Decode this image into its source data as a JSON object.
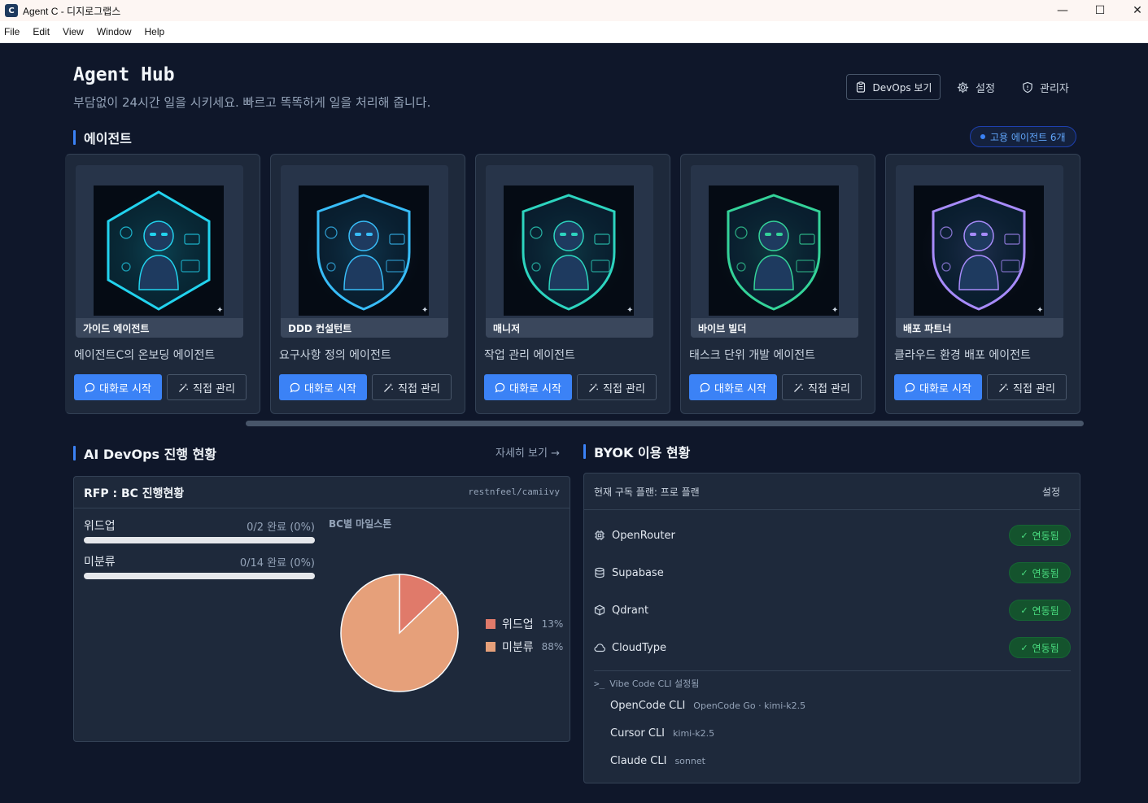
{
  "window": {
    "title": "Agent C - 디지로그랩스",
    "menu": [
      "File",
      "Edit",
      "View",
      "Window",
      "Help"
    ]
  },
  "header": {
    "title": "Agent Hub",
    "subtitle": "부담없이 24시간 일을 시키세요. 빠르고 똑똑하게 일을 처리해 줍니다.",
    "devops_button": "DevOps 보기",
    "settings_label": "설정",
    "admin_label": "관리자"
  },
  "agents_section": {
    "title": "에이전트",
    "hired_badge": "고용 에이전트 6개",
    "chat_label": "대화로 시작",
    "manage_label": "직접 관리",
    "agents": [
      {
        "name": "가이드 에이전트",
        "description": "에이전트C의 온보딩 에이전트",
        "accent": "#22d3ee"
      },
      {
        "name": "DDD 컨설턴트",
        "description": "요구사항 정의 에이전트",
        "accent": "#38bdf8"
      },
      {
        "name": "매니저",
        "description": "작업 관리 에이전트",
        "accent": "#2dd4bf"
      },
      {
        "name": "바이브 빌더",
        "description": "태스크 단위 개발 에이전트",
        "accent": "#34d399"
      },
      {
        "name": "배포 파트너",
        "description": "클라우드 환경 배포 에이전트",
        "accent": "#a78bfa"
      }
    ]
  },
  "devops_section": {
    "title": "AI DevOps 진행 현황",
    "detail_link": "자세히 보기 →",
    "panel_title": "RFP : BC 진행현황",
    "repo": "restnfeel/camiivy",
    "milestone_title": "BC별 마일스톤",
    "progress": [
      {
        "label": "위드업",
        "status": "0/2 완료 (0%)",
        "percent": 0
      },
      {
        "label": "미분류",
        "status": "0/14 완료 (0%)",
        "percent": 0
      }
    ]
  },
  "chart_data": {
    "type": "pie",
    "categories": [
      "위드업",
      "미분류"
    ],
    "values": [
      13,
      88
    ],
    "value_labels": [
      "13%",
      "88%"
    ],
    "colors": [
      "#e07a6a",
      "#e6a07a"
    ],
    "legend": "right"
  },
  "byok_section": {
    "title": "BYOK 이용 현황",
    "plan_text": "현재 구독 플랜: 프로 플랜",
    "settings_link": "설정",
    "connected_label": "연동됨",
    "services": [
      {
        "name": "OpenRouter",
        "icon": "chip-icon"
      },
      {
        "name": "Supabase",
        "icon": "database-icon"
      },
      {
        "name": "Qdrant",
        "icon": "cube-icon"
      },
      {
        "name": "CloudType",
        "icon": "cloud-icon"
      }
    ],
    "cli_header": "Vibe Code CLI 설정됨",
    "cli": [
      {
        "name": "OpenCode CLI",
        "meta": "OpenCode Go · kimi-k2.5"
      },
      {
        "name": "Cursor CLI",
        "meta": "kimi-k2.5"
      },
      {
        "name": "Claude CLI",
        "meta": "sonnet"
      }
    ]
  }
}
